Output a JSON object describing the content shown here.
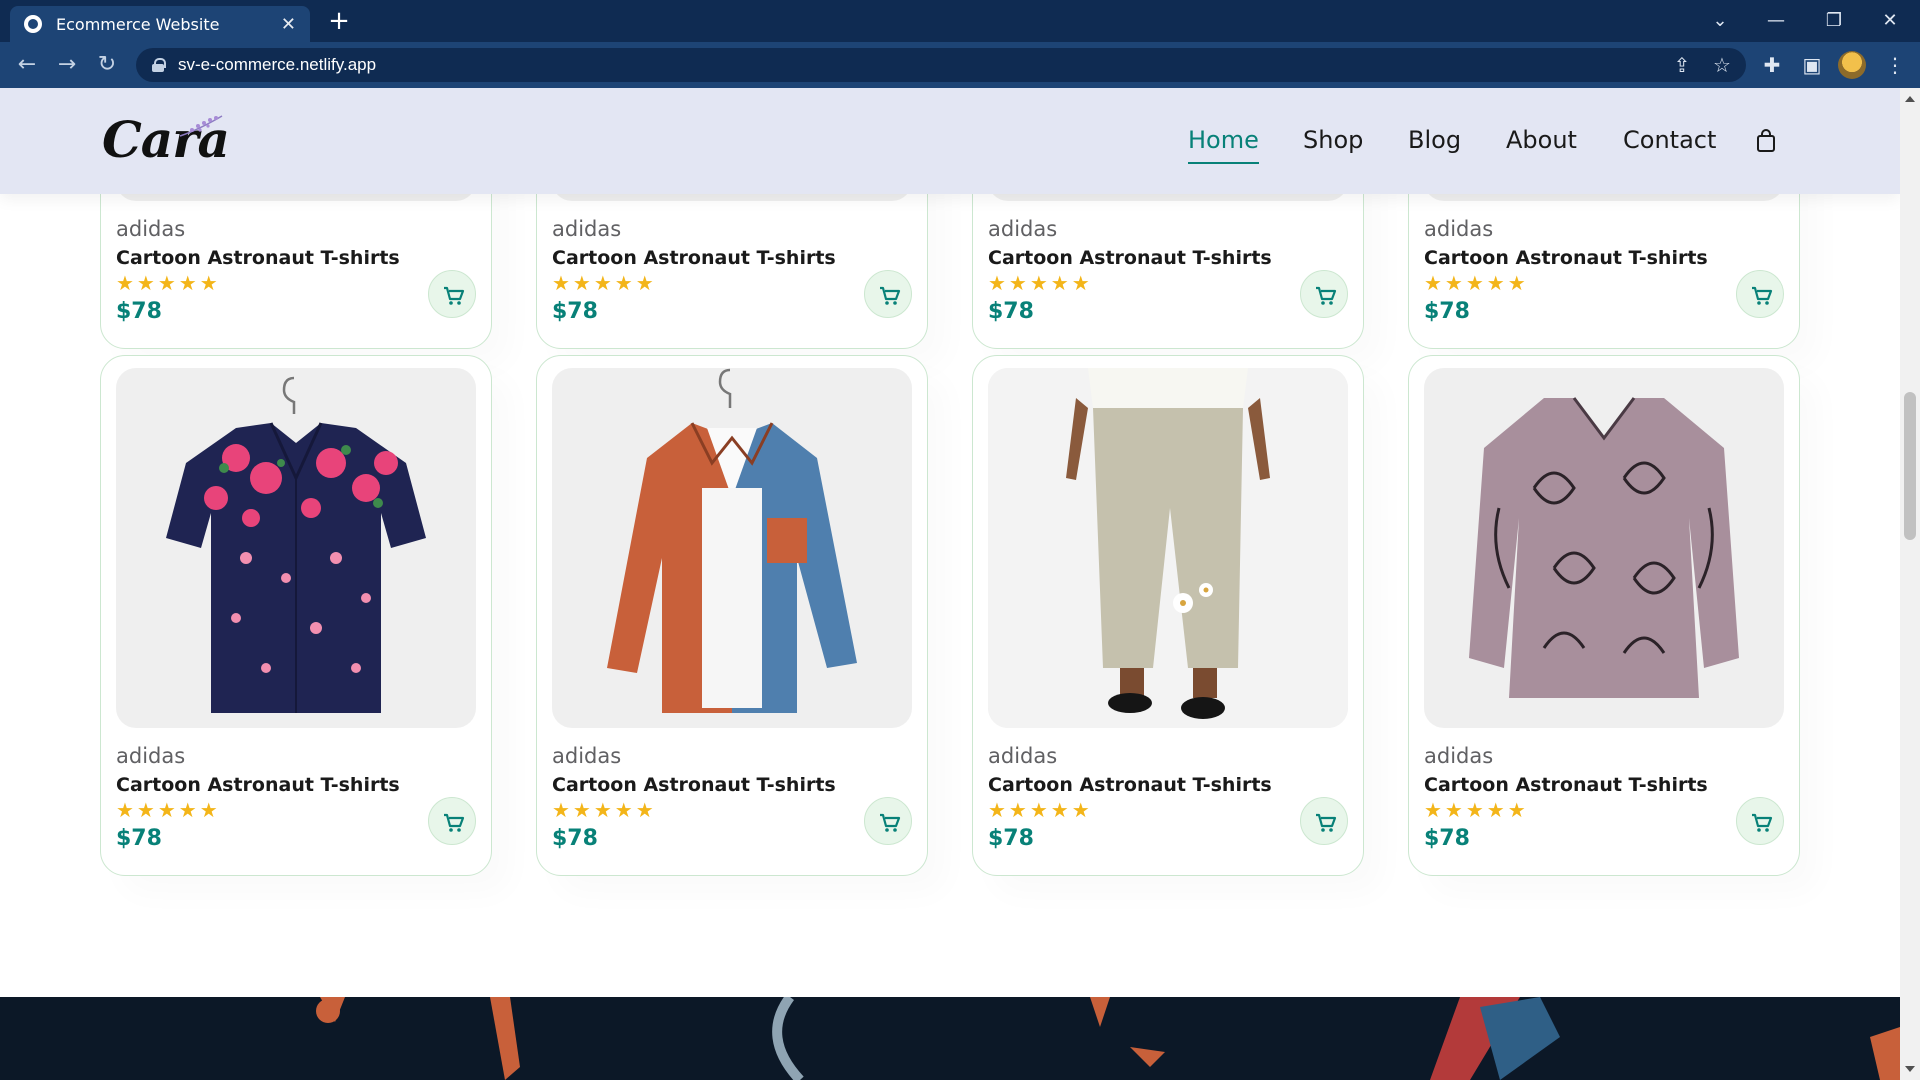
{
  "browser": {
    "tab_title": "Ecommerce Website",
    "tab_close": "✕",
    "new_tab": "+",
    "url": "sv-e-commerce.netlify.app",
    "controls": {
      "tabsearch": "⌄",
      "minimize": "—",
      "restore": "❐",
      "close": "✕"
    },
    "nav": {
      "back": "←",
      "forward": "→",
      "reload": "↻"
    }
  },
  "header": {
    "logo": "Cara",
    "nav_items": [
      {
        "label": "Home",
        "active": true
      },
      {
        "label": "Shop"
      },
      {
        "label": "Blog"
      },
      {
        "label": "About"
      },
      {
        "label": "Contact"
      }
    ]
  },
  "products": {
    "top_row": [
      {
        "brand": "adidas",
        "name": "Cartoon Astronaut T-shirts",
        "stars": "★★★★★",
        "price": "$78"
      },
      {
        "brand": "adidas",
        "name": "Cartoon Astronaut T-shirts",
        "stars": "★★★★★",
        "price": "$78"
      },
      {
        "brand": "adidas",
        "name": "Cartoon Astronaut T-shirts",
        "stars": "★★★★★",
        "price": "$78"
      },
      {
        "brand": "adidas",
        "name": "Cartoon Astronaut T-shirts",
        "stars": "★★★★★",
        "price": "$78"
      }
    ],
    "bottom_row": [
      {
        "brand": "adidas",
        "name": "Cartoon Astronaut T-shirts",
        "stars": "★★★★★",
        "price": "$78",
        "image": "floral-shirt"
      },
      {
        "brand": "adidas",
        "name": "Cartoon Astronaut T-shirts",
        "stars": "★★★★★",
        "price": "$78",
        "image": "corduroy-shirt"
      },
      {
        "brand": "adidas",
        "name": "Cartoon Astronaut T-shirts",
        "stars": "★★★★★",
        "price": "$78",
        "image": "linen-trousers"
      },
      {
        "brand": "adidas",
        "name": "Cartoon Astronaut T-shirts",
        "stars": "★★★★★",
        "price": "$78",
        "image": "cat-print-blouse"
      }
    ]
  },
  "colors": {
    "accent": "#088178",
    "header_bg": "#e3e6f3",
    "star": "#f3b519",
    "chrome_dark": "#0f2b52",
    "chrome_light": "#1d4475"
  }
}
